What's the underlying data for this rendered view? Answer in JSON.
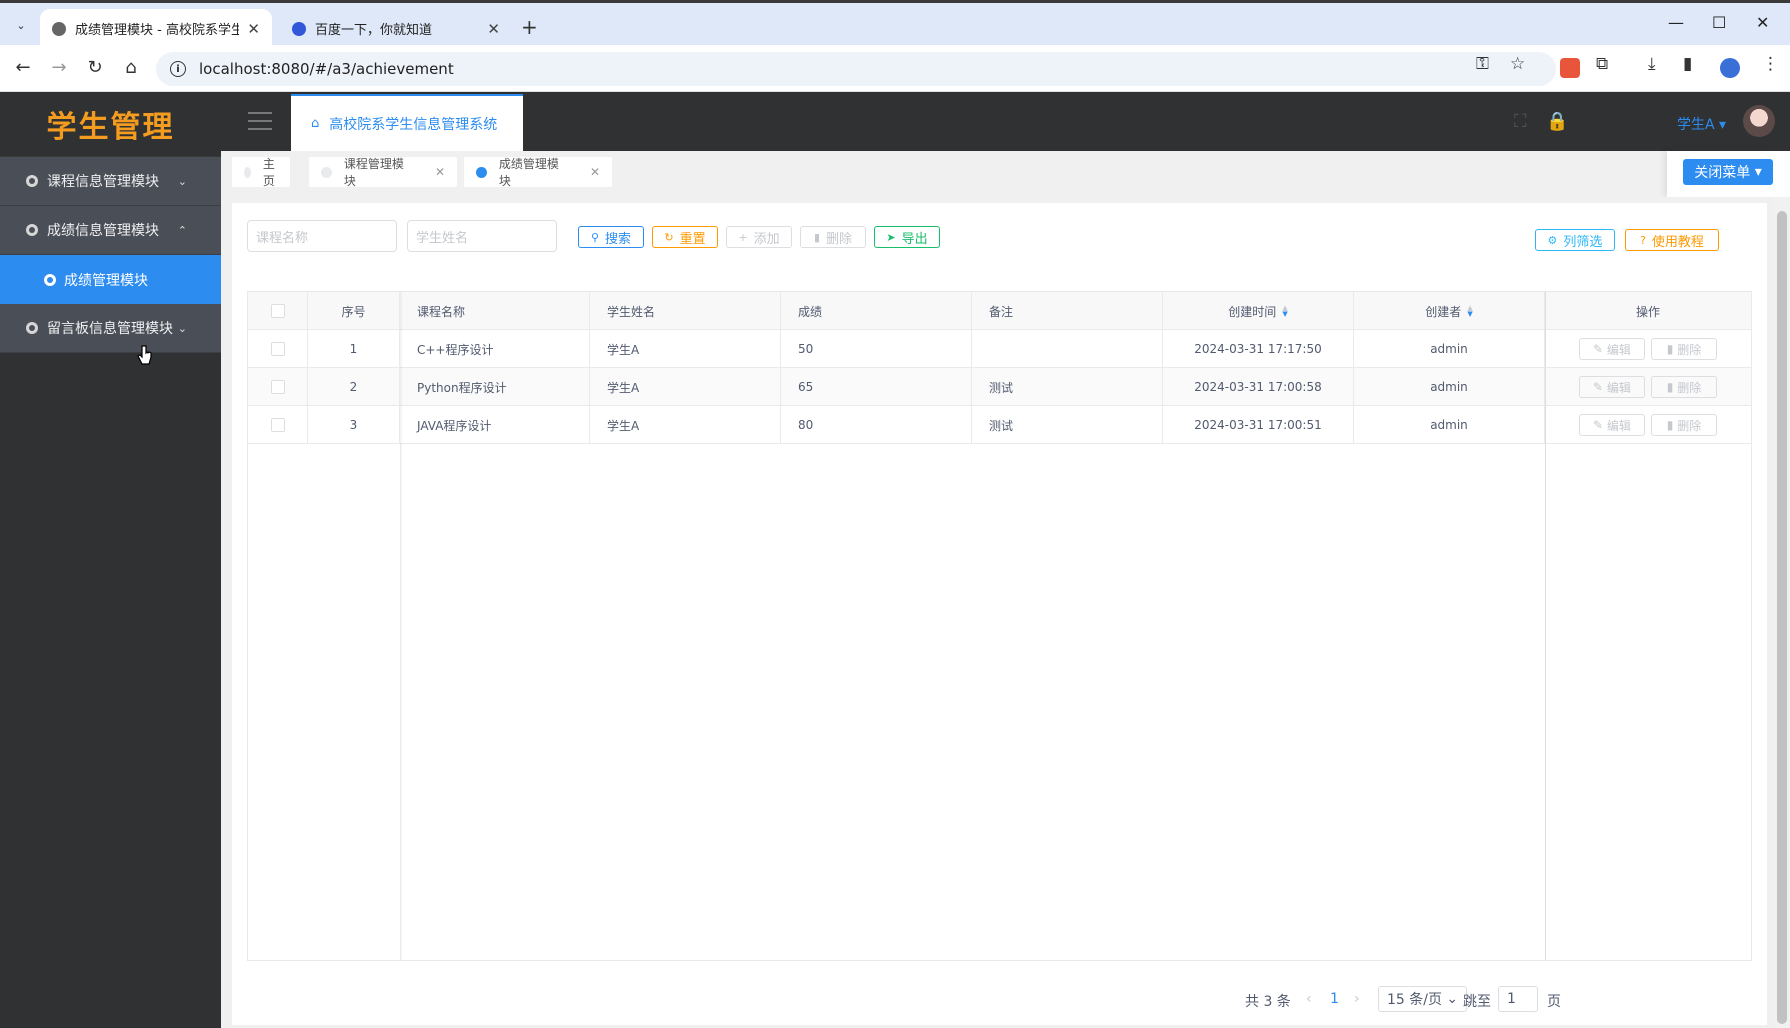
{
  "browser": {
    "tabs": [
      {
        "title": "成绩管理模块 - 高校院系学生信",
        "active": true
      },
      {
        "title": "百度一下，你就知道",
        "active": false
      }
    ],
    "url": "localhost:8080/#/a3/achievement"
  },
  "app": {
    "logo": "学生管理",
    "header_tab": "高校院系学生信息管理系统",
    "user": "学生A",
    "close_menu": "关闭菜单"
  },
  "sidebar": {
    "items": [
      {
        "label": "课程信息管理模块",
        "expanded": false
      },
      {
        "label": "成绩信息管理模块",
        "expanded": true,
        "children": [
          {
            "label": "成绩管理模块",
            "active": true
          }
        ]
      },
      {
        "label": "留言板信息管理模块",
        "expanded": false
      }
    ]
  },
  "tags": [
    {
      "label": "主页"
    },
    {
      "label": "课程管理模块"
    },
    {
      "label": "成绩管理模块"
    }
  ],
  "toolbar": {
    "course_placeholder": "课程名称",
    "student_placeholder": "学生姓名",
    "search": "搜索",
    "reset": "重置",
    "add": "添加",
    "delete": "删除",
    "export": "导出",
    "column_filter": "列筛选",
    "tutorial": "使用教程"
  },
  "table": {
    "columns": [
      "序号",
      "课程名称",
      "学生姓名",
      "成绩",
      "备注",
      "创建时间",
      "创建者",
      "操作"
    ],
    "rows": [
      {
        "no": "1",
        "course": "C++程序设计",
        "student": "学生A",
        "score": "50",
        "remark": "",
        "created": "2024-03-31 17:17:50",
        "creator": "admin"
      },
      {
        "no": "2",
        "course": "Python程序设计",
        "student": "学生A",
        "score": "65",
        "remark": "测试",
        "created": "2024-03-31 17:00:58",
        "creator": "admin"
      },
      {
        "no": "3",
        "course": "JAVA程序设计",
        "student": "学生A",
        "score": "80",
        "remark": "测试",
        "created": "2024-03-31 17:00:51",
        "creator": "admin"
      }
    ],
    "edit_label": "编辑",
    "delete_label": "删除"
  },
  "pagination": {
    "total": "共 3 条",
    "current": "1",
    "page_size": "15 条/页",
    "jump_label": "跳至",
    "jump_value": "1",
    "page_suffix": "页"
  },
  "colors": {
    "primary": "#2d8cf0",
    "warning": "#ff9900",
    "success": "#19be6b",
    "sidebar_bg": "#303133",
    "logo": "#f39c1f"
  }
}
